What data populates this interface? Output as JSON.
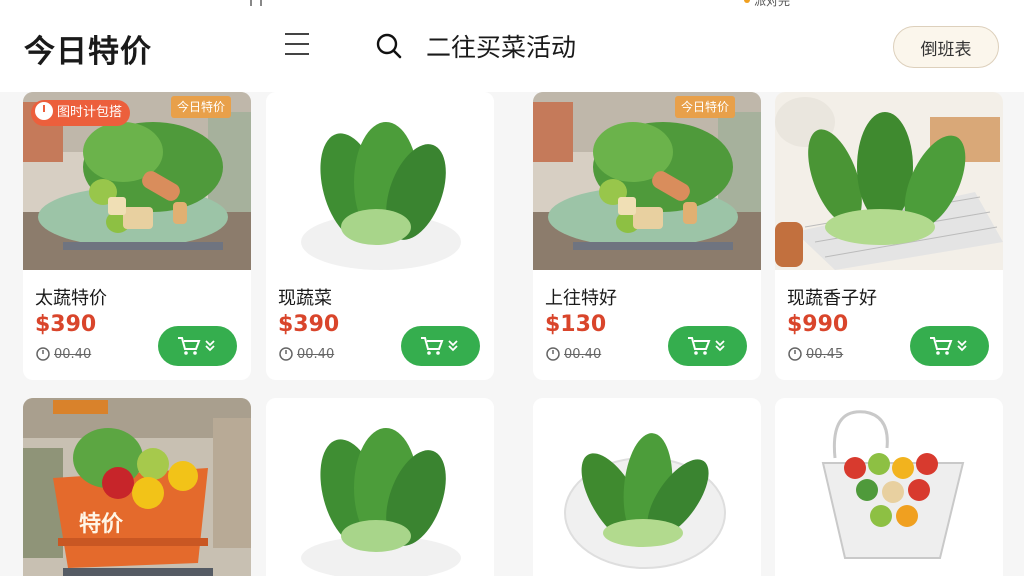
{
  "status": {
    "text": "派对完"
  },
  "header": {
    "title": "今日特价",
    "search_label": "二往买菜活动",
    "action_button": "倒班表",
    "icons": [
      "menu-icon",
      "search-icon"
    ]
  },
  "products": [
    {
      "name": "太蔬特价",
      "price": "$390",
      "old_price": "00.40",
      "badge": "图时计包搭",
      "sign": "今日特价"
    },
    {
      "name": "现蔬菜",
      "price": "$390",
      "old_price": "00.40"
    },
    {
      "name": "上往特好",
      "price": "$130",
      "old_price": "00.40",
      "sign": "今日特价"
    },
    {
      "name": "现蔬香子好",
      "price": "$990",
      "old_price": "00.45"
    }
  ],
  "second_row": {
    "basket_text": "特价"
  },
  "colors": {
    "price": "#d9452b",
    "cart_button": "#35ae4e",
    "badge": "#ec5f3c",
    "background": "#f6f6f6"
  }
}
